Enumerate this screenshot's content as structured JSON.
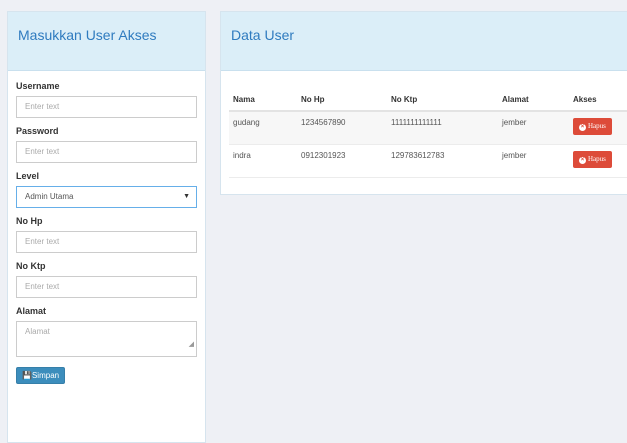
{
  "left_panel": {
    "title": "Masukkan User Akses",
    "username": {
      "label": "Username",
      "placeholder": "Enter text"
    },
    "password": {
      "label": "Password",
      "placeholder": "Enter text"
    },
    "level": {
      "label": "Level",
      "value": "Admin Utama"
    },
    "no_hp": {
      "label": "No Hp",
      "placeholder": "Enter text"
    },
    "no_ktp": {
      "label": "No Ktp",
      "placeholder": "Enter text"
    },
    "alamat": {
      "label": "Alamat",
      "placeholder": "Alamat"
    },
    "save_icon": "floppy-icon",
    "save_label": "Simpan"
  },
  "right_panel": {
    "title": "Data User",
    "columns": [
      "Nama",
      "No Hp",
      "No Ktp",
      "Alamat",
      "Akses"
    ],
    "rows": [
      {
        "nama": "gudang",
        "no_hp": "1234567890",
        "no_ktp": "1111111111111",
        "alamat": "jember",
        "akses": "Hapus"
      },
      {
        "nama": "indra",
        "no_hp": "0912301923",
        "no_ktp": "129783612783",
        "alamat": "jember",
        "akses": "Hapus"
      }
    ]
  },
  "colors": {
    "accent": "#3c8dbc",
    "danger": "#dd4b39",
    "header_bg": "#dbeef8"
  }
}
